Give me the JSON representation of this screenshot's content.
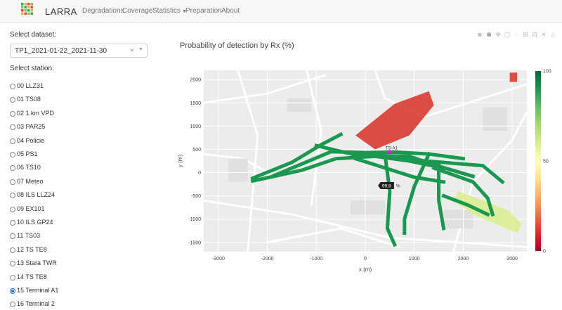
{
  "nav": {
    "brand": "LARRA",
    "items": [
      "Degradations",
      "Coverage",
      "Statistics",
      "Preparation",
      "About"
    ]
  },
  "sidebar": {
    "dataset_label": "Select dataset:",
    "dataset_value": "TP1_2021-01-22_2021-11-30",
    "station_label": "Select station:",
    "stations": [
      {
        "label": "00 LLZ31",
        "selected": false
      },
      {
        "label": "01 TS08",
        "selected": false
      },
      {
        "label": "02 1.km VPD",
        "selected": false
      },
      {
        "label": "03 PAR25",
        "selected": false
      },
      {
        "label": "04 Policie",
        "selected": false
      },
      {
        "label": "05 PS1",
        "selected": false
      },
      {
        "label": "06 TS10",
        "selected": false
      },
      {
        "label": "07 Meteo",
        "selected": false
      },
      {
        "label": "08 ILS LLZ24",
        "selected": false
      },
      {
        "label": "09 EX101",
        "selected": false
      },
      {
        "label": "10 ILS GP24",
        "selected": false
      },
      {
        "label": "11 TS03",
        "selected": false
      },
      {
        "label": "12 TS TE8",
        "selected": false
      },
      {
        "label": "13 Stara TWR",
        "selected": false
      },
      {
        "label": "14 TS TE8",
        "selected": false
      },
      {
        "label": "15 Terminal A1",
        "selected": true
      },
      {
        "label": "16 Terminal 2",
        "selected": false
      }
    ]
  },
  "toolbar": {
    "icons": [
      "camera-icon",
      "zoom-icon",
      "pan-icon",
      "box-select-icon",
      "lasso-icon",
      "zoom-in-icon",
      "zoom-out-icon",
      "autoscale-icon",
      "home-icon"
    ]
  },
  "chart_data": {
    "type": "heatmap",
    "title": "Probability of detection by Rx (%)",
    "xlabel": "x (m)",
    "ylabel": "y (m)",
    "x_ticks": [
      -3000,
      -2000,
      -1000,
      0,
      1000,
      2000,
      3000
    ],
    "y_ticks": [
      2000,
      1500,
      1000,
      500,
      0,
      -500,
      -1000,
      -1500
    ],
    "xlim": [
      -3300,
      3300
    ],
    "ylim": [
      -1700,
      2200
    ],
    "colorscale": {
      "min": 0,
      "max": 100,
      "ticks": [
        100,
        50,
        0
      ],
      "colors": [
        "#a50026",
        "#d73027",
        "#f46d43",
        "#fdae61",
        "#fee08b",
        "#ffffbf",
        "#d9ef8b",
        "#a6d96a",
        "#66bd63",
        "#1a9850",
        "#006837"
      ]
    },
    "station_marker": {
      "x": 500,
      "y": 440,
      "label": "TS-A1"
    },
    "hover_label": {
      "x": 300,
      "y": -280,
      "value": "99.8",
      "unit": "%"
    },
    "zones": [
      {
        "kind": "poor",
        "value": 5,
        "polygon": [
          [
            -200,
            800
          ],
          [
            600,
            1480
          ],
          [
            1300,
            1750
          ],
          [
            1400,
            1450
          ],
          [
            900,
            800
          ],
          [
            200,
            500
          ]
        ]
      },
      {
        "kind": "poor",
        "value": 5,
        "polygon": [
          [
            2950,
            2150
          ],
          [
            3100,
            2150
          ],
          [
            3100,
            1950
          ],
          [
            2950,
            1950
          ]
        ]
      },
      {
        "kind": "mixed",
        "value": 55,
        "polygon": [
          [
            1900,
            -400
          ],
          [
            2900,
            -800
          ],
          [
            3200,
            -1100
          ],
          [
            3100,
            -1300
          ],
          [
            2200,
            -900
          ],
          [
            1800,
            -600
          ]
        ]
      }
    ],
    "paths": [
      {
        "value": 92,
        "points": [
          [
            -2300,
            -120
          ],
          [
            -1500,
            220
          ],
          [
            -900,
            600
          ],
          [
            -500,
            820
          ]
        ]
      },
      {
        "value": 92,
        "points": [
          [
            -2300,
            -180
          ],
          [
            -1300,
            50
          ],
          [
            -600,
            300
          ],
          [
            200,
            350
          ],
          [
            900,
            250
          ],
          [
            1600,
            100
          ]
        ]
      },
      {
        "value": 92,
        "points": [
          [
            -1900,
            -80
          ],
          [
            -700,
            450
          ],
          [
            0,
            430
          ],
          [
            600,
            440
          ],
          [
            1300,
            400
          ],
          [
            2000,
            300
          ]
        ]
      },
      {
        "value": 92,
        "points": [
          [
            -1000,
            580
          ],
          [
            -200,
            380
          ],
          [
            400,
            360
          ],
          [
            900,
            350
          ],
          [
            1400,
            170
          ],
          [
            2200,
            -80
          ]
        ]
      },
      {
        "value": 92,
        "points": [
          [
            400,
            400
          ],
          [
            500,
            -400
          ],
          [
            450,
            -1200
          ],
          [
            600,
            -1550
          ]
        ]
      },
      {
        "value": 92,
        "points": [
          [
            1300,
            400
          ],
          [
            1000,
            -300
          ],
          [
            800,
            -1000
          ],
          [
            800,
            -1300
          ]
        ]
      },
      {
        "value": 92,
        "points": [
          [
            1500,
            200
          ],
          [
            1500,
            -600
          ],
          [
            1600,
            -1200
          ]
        ]
      },
      {
        "value": 92,
        "points": [
          [
            1400,
            100
          ],
          [
            2200,
            -200
          ],
          [
            2500,
            -550
          ],
          [
            2600,
            -900
          ]
        ]
      },
      {
        "value": 92,
        "points": [
          [
            1600,
            -500
          ],
          [
            2100,
            -700
          ],
          [
            2500,
            -900
          ]
        ]
      },
      {
        "value": 92,
        "points": [
          [
            700,
            300
          ],
          [
            1800,
            200
          ],
          [
            2400,
            150
          ],
          [
            2800,
            -200
          ]
        ]
      },
      {
        "value": 92,
        "points": [
          [
            -200,
            300
          ],
          [
            400,
            100
          ],
          [
            1000,
            -100
          ],
          [
            1600,
            -200
          ]
        ]
      }
    ]
  }
}
